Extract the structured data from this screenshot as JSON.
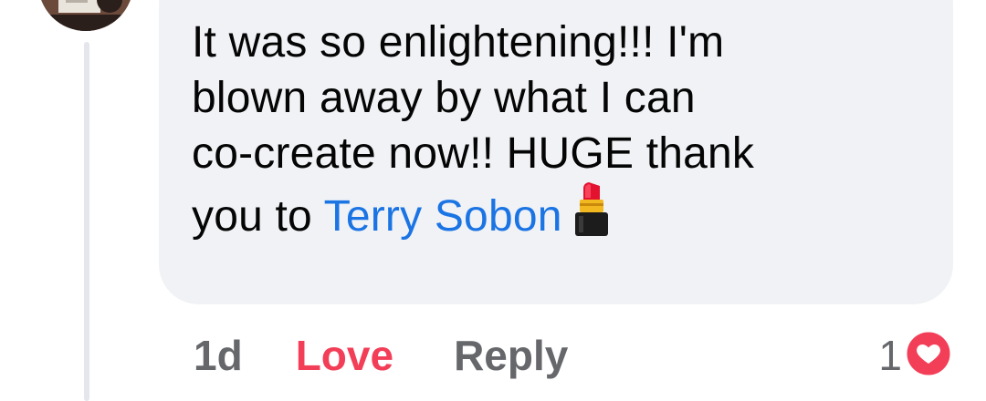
{
  "comment": {
    "text_line1": "It was so enlightening!!! I'm",
    "text_line2": "blown away by what I can",
    "text_line3": "co-create now!! HUGE thank",
    "text_line4_prefix": "you to ",
    "mention": "Terry Sobon",
    "emoji_icon": "lipstick-icon"
  },
  "actions": {
    "time": "1d",
    "reaction_label": "Love",
    "reply_label": "Reply"
  },
  "reactions": {
    "count": "1",
    "icon": "love-heart-icon"
  },
  "colors": {
    "bubble": "#f0f2f5",
    "mention": "#1b74e4",
    "love": "#f33e58",
    "secondary": "#65676b"
  }
}
